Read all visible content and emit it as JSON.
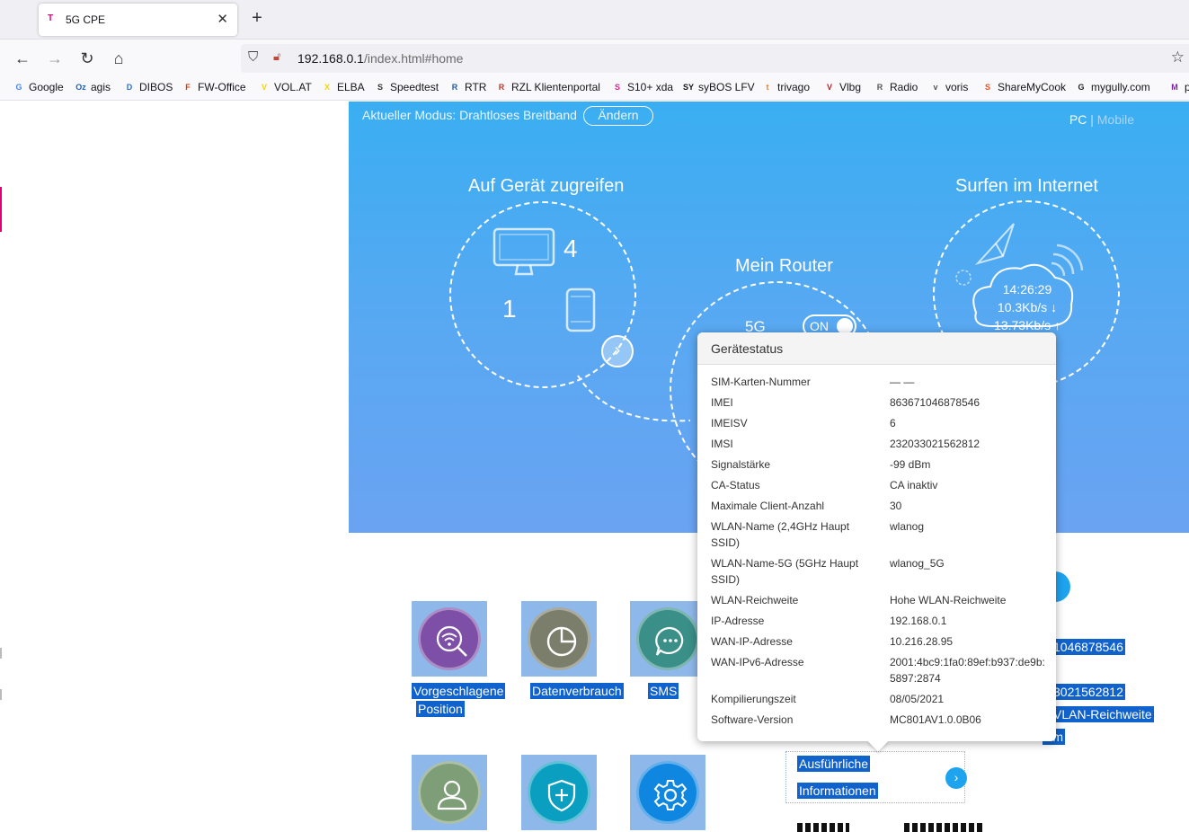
{
  "browser": {
    "tab_title": "5G CPE",
    "tab_favicon": "T",
    "url_host": "192.168.0.1",
    "url_path": "/index.html#home",
    "bookmarks": [
      {
        "label": "Google",
        "icon": "G",
        "color": "#4285f4"
      },
      {
        "label": "agis",
        "icon": "Oz",
        "color": "#1a5fb4"
      },
      {
        "label": "DIBOS",
        "icon": "D",
        "color": "#2a6fd6"
      },
      {
        "label": "FW-Office",
        "icon": "F",
        "color": "#d83b01"
      },
      {
        "label": "VOL.AT",
        "icon": "V",
        "color": "#f5d400"
      },
      {
        "label": "ELBA",
        "icon": "X",
        "color": "#f5d400"
      },
      {
        "label": "Speedtest",
        "icon": "S",
        "color": "#333333"
      },
      {
        "label": "RTR",
        "icon": "R",
        "color": "#1d5ea8"
      },
      {
        "label": "RZL Klientenportal",
        "icon": "R",
        "color": "#c0392b"
      },
      {
        "label": "S10+ xda",
        "icon": "S",
        "color": "#e0208a"
      },
      {
        "label": "syBOS LFV",
        "icon": "SY",
        "color": "#111111"
      },
      {
        "label": "trivago",
        "icon": "t",
        "color": "#e67e22"
      },
      {
        "label": "Vlbg",
        "icon": "V",
        "color": "#b22222"
      },
      {
        "label": "Radio",
        "icon": "R",
        "color": "#555555"
      },
      {
        "label": "voris",
        "icon": "v",
        "color": "#555555"
      },
      {
        "label": "ShareMyCook",
        "icon": "S",
        "color": "#e8501d"
      },
      {
        "label": "mygully.com",
        "icon": "G",
        "color": "#222222"
      },
      {
        "label": "p",
        "icon": "M",
        "color": "#7a1fa2"
      }
    ]
  },
  "hero": {
    "mode_label": "Aktueller Modus: Drahtloses Breitband",
    "mode_button": "Ändern",
    "view_pc": "PC",
    "view_sep": "|",
    "view_mobile": "Mobile",
    "access_title": "Auf Gerät zugreifen",
    "pc_count": "4",
    "phone_count": "1",
    "router_title": "Mein Router",
    "band_label": "5G",
    "toggle_label": "ON",
    "internet_title": "Surfen im Internet",
    "time": "14:26:29",
    "down_rate": "10.3Kb/s ↓",
    "up_rate": "13.73Kb/s ↑"
  },
  "tiles": [
    {
      "label_line1": "Vorgeschlagene",
      "label_line2": "Position",
      "color": "#7e4fa6"
    },
    {
      "label_line1": "Datenverbrauch",
      "label_line2": "",
      "color": "#7c7e6c"
    },
    {
      "label_line1": "SMS",
      "label_line2": "",
      "color": "#3a8f88"
    },
    {
      "label_line1": "",
      "label_line2": "",
      "color": "#7e9e78"
    },
    {
      "label_line1": "",
      "label_line2": "",
      "color": "#0a9ec0"
    },
    {
      "label_line1": "",
      "label_line2": "",
      "color": "#0f86e0"
    }
  ],
  "background_fragments": {
    "imei_partial": "1046878546",
    "imsi_partial": "3021562812",
    "wlan_partial": "VLAN-Reichweite",
    "dbm_partial": "Bm",
    "details_line1": "Ausführliche",
    "details_line2": "Informationen"
  },
  "popup": {
    "title": "Gerätestatus",
    "rows": [
      {
        "key": "SIM-Karten-Nummer",
        "value": "— —"
      },
      {
        "key": "IMEI",
        "value": "863671046878546"
      },
      {
        "key": "IMEISV",
        "value": "6"
      },
      {
        "key": "IMSI",
        "value": "232033021562812"
      },
      {
        "key": "Signalstärke",
        "value": "-99 dBm"
      },
      {
        "key": "CA-Status",
        "value": "CA inaktiv"
      },
      {
        "key": "Maximale Client-Anzahl",
        "value": "30"
      },
      {
        "key": "WLAN-Name (2,4GHz Haupt SSID)",
        "value": "wlanog"
      },
      {
        "key": "WLAN-Name-5G (5GHz Haupt SSID)",
        "value": "wlanog_5G"
      },
      {
        "key": "WLAN-Reichweite",
        "value": "Hohe WLAN-Reichweite"
      },
      {
        "key": "IP-Adresse",
        "value": "192.168.0.1"
      },
      {
        "key": "WAN-IP-Adresse",
        "value": "10.216.28.95"
      },
      {
        "key": "WAN-IPv6-Adresse",
        "value": "2001:4bc9:1fa0:89ef:b937:de9b:5897:2874"
      },
      {
        "key": "Kompilierungszeit",
        "value": "08/05/2021"
      },
      {
        "key": "Software-Version",
        "value": "MC801AV1.0.0B06"
      }
    ]
  }
}
